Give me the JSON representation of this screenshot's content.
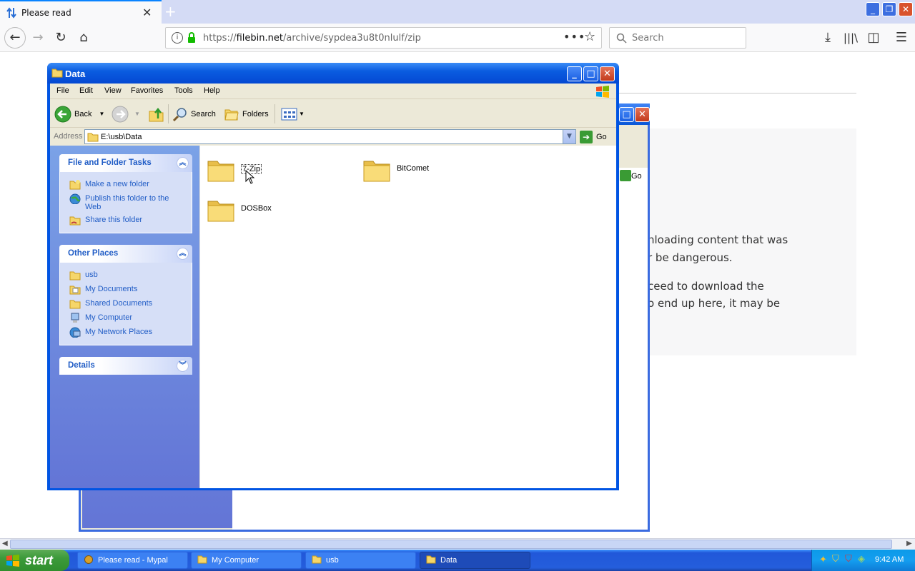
{
  "browser": {
    "tab_title": "Please read",
    "url_prefix": "https://",
    "url_domain": "filebin.net",
    "url_path": "/archive/sypdea3u8t0nlulf/zip",
    "search_placeholder": "Search"
  },
  "page": {
    "lines": [
      "nloading content that was",
      "r be dangerous.",
      "ceed to download the",
      "o end up here, it may be"
    ]
  },
  "back_window": {
    "go_label": "Go"
  },
  "explorer": {
    "title": "Data",
    "menu": [
      "File",
      "Edit",
      "View",
      "Favorites",
      "Tools",
      "Help"
    ],
    "toolbar": {
      "back": "Back",
      "search": "Search",
      "folders": "Folders"
    },
    "address_label": "Address",
    "address_value": "E:\\usb\\Data",
    "go_label": "Go",
    "tasks_panel": {
      "title": "File and Folder Tasks",
      "items": [
        "Make a new folder",
        "Publish this folder to the Web",
        "Share this folder"
      ]
    },
    "places_panel": {
      "title": "Other Places",
      "items": [
        "usb",
        "My Documents",
        "Shared Documents",
        "My Computer",
        "My Network Places"
      ]
    },
    "details_panel": {
      "title": "Details"
    },
    "folders": [
      "7-Zip",
      "BitComet",
      "DOSBox"
    ]
  },
  "taskbar": {
    "start": "start",
    "tasks": [
      "Please read - Mypal",
      "My Computer",
      "usb",
      "Data"
    ],
    "active_task": "Data",
    "clock": "9:42 AM"
  },
  "colors": {
    "xp_title_blue": "#0a5ce0",
    "taskpane_blue": "#7ba2e7",
    "link_blue": "#215dc6",
    "start_green": "#3c9a3a"
  }
}
